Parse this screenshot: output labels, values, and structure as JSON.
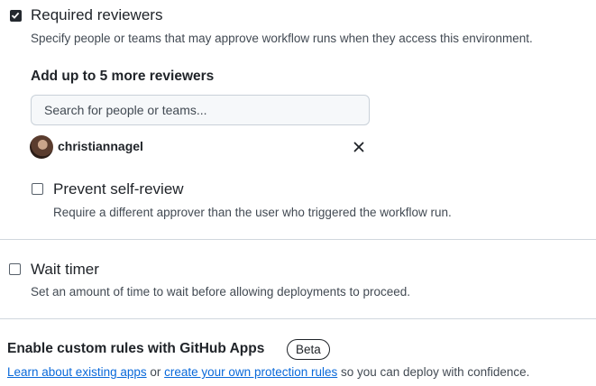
{
  "required_reviewers": {
    "checked": true,
    "label": "Required reviewers",
    "description": "Specify people or teams that may approve workflow runs when they access this environment.",
    "add_heading": "Add up to 5 more reviewers",
    "search_placeholder": "Search for people or teams...",
    "reviewers": [
      {
        "username": "christiannagel"
      }
    ],
    "prevent_self_review": {
      "checked": false,
      "label": "Prevent self-review",
      "description": "Require a different approver than the user who triggered the workflow run."
    }
  },
  "wait_timer": {
    "checked": false,
    "label": "Wait timer",
    "description": "Set an amount of time to wait before allowing deployments to proceed."
  },
  "custom_rules": {
    "heading": "Enable custom rules with GitHub Apps",
    "badge": "Beta",
    "link_existing": "Learn about existing apps",
    "text_or": " or ",
    "link_create": "create your own protection rules",
    "text_tail": " so you can deploy with confidence."
  },
  "colors": {
    "link": "#0969da",
    "checkbox_checked": "#24292f",
    "divider": "#d0d7de"
  }
}
